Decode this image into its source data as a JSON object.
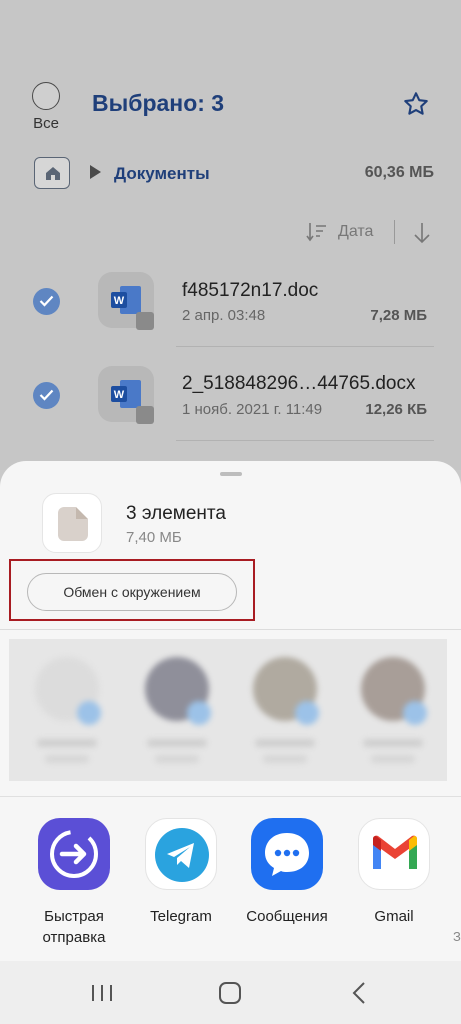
{
  "header": {
    "select_all_label": "Все",
    "title": "Выбрано: 3"
  },
  "breadcrumb": {
    "folder": "Документы",
    "size": "60,36 МБ"
  },
  "sort": {
    "label": "Дата"
  },
  "files": [
    {
      "name": "f485172n17.doc",
      "date": "2 апр. 03:48",
      "size": "7,28 МБ"
    },
    {
      "name": "2_518848296…44765.docx",
      "date": "1 нояб. 2021 г. 11:49",
      "size": "12,26 КБ"
    }
  ],
  "share_sheet": {
    "title": "3 элемента",
    "subtitle": "7,40 МБ",
    "nearby_button": "Обмен с окружением",
    "apps": [
      {
        "label": "Быстрая отправка",
        "icon": "quick-share-icon",
        "color": "#5b4fd6"
      },
      {
        "label": "Telegram",
        "icon": "telegram-icon",
        "color": "#2aa3df"
      },
      {
        "label": "Сообщения",
        "icon": "messages-icon",
        "color": "#1f6ff0"
      },
      {
        "label": "Gmail",
        "icon": "gmail-icon",
        "color": "#ea4335"
      }
    ],
    "next_app_peek": "З"
  },
  "colors": {
    "accent": "#1f3f7a",
    "check": "#5f86c2",
    "highlight": "#a81c22"
  }
}
